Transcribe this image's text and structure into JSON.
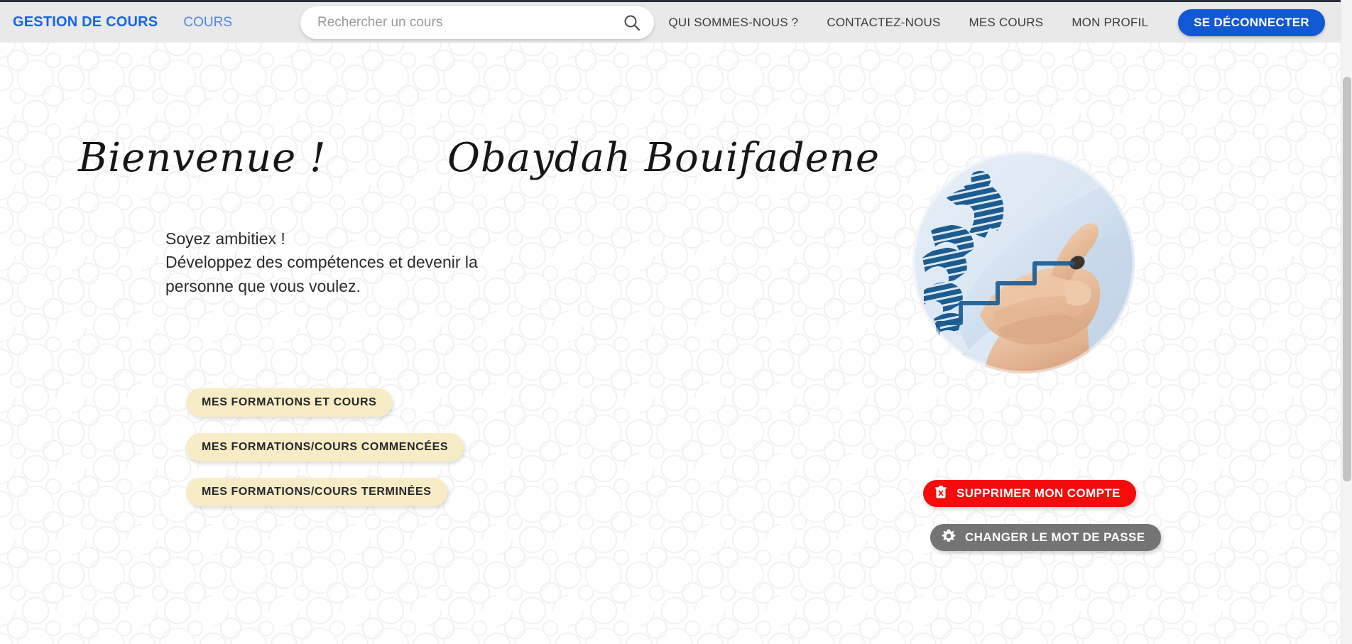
{
  "navbar": {
    "brand": "GESTION DE COURS",
    "cours_link": "COURS",
    "search": {
      "placeholder": "Rechercher un cours",
      "value": "",
      "icon": "search-icon"
    },
    "links": [
      {
        "label": "QUI SOMMES-NOUS ?"
      },
      {
        "label": "CONTACTEZ-NOUS"
      },
      {
        "label": "MES COURS"
      },
      {
        "label": "MON PROFIL"
      }
    ],
    "logout_label": "SE DÉCONNECTER",
    "background_color": "#e9e9e9",
    "brand_color": "#1565ea",
    "logout_color": "#1158d4"
  },
  "hero": {
    "welcome_word": "Bienvenue !",
    "user_name": "Obaydah Bouifadene",
    "tagline_line1": "Soyez ambitiex !",
    "tagline_line2": "Développez des compétences et devenir la",
    "tagline_line3": "personne que vous voulez.",
    "pills": [
      {
        "label": "MES FORMATIONS ET COURS"
      },
      {
        "label": "MES FORMATIONS/COURS COMMENCÉES"
      },
      {
        "label": "MES FORMATIONS/COURS TERMINÉES"
      }
    ],
    "pill_color": "#f7ecc6",
    "photo_alt": "hand drawing ascending growth chart with climbing figure"
  },
  "account_actions": {
    "delete": {
      "label": "SUPPRIMER MON COMPTE",
      "icon": "trash-icon",
      "color": "#f50b0b"
    },
    "password": {
      "label": "CHANGER LE MOT DE PASSE",
      "icon": "gear-icon",
      "color": "#747474"
    }
  }
}
